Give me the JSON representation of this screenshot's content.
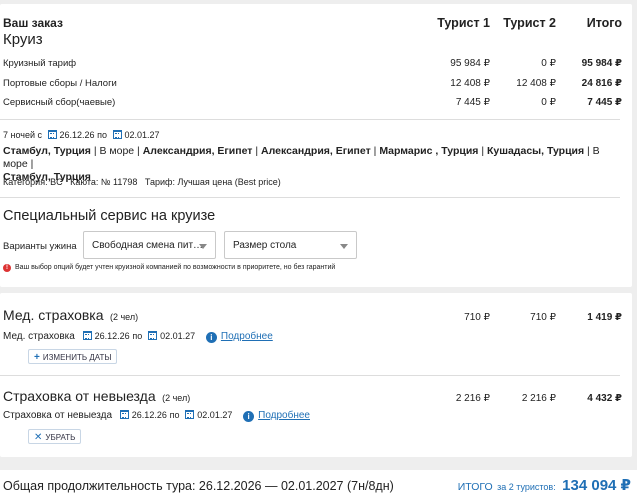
{
  "order": {
    "title": "Ваш заказ",
    "subtitle": "Круиз",
    "columns": [
      "Турист 1",
      "Турист 2",
      "Итого"
    ],
    "rows": [
      {
        "label": "Круизный тариф",
        "t1": "95 984 ₽",
        "t2": "0 ₽",
        "total": "95 984 ₽"
      },
      {
        "label": "Портовые сборы / Налоги",
        "t1": "12 408 ₽",
        "t2": "12 408 ₽",
        "total": "24 816 ₽"
      },
      {
        "label": "Сервисный сбор(чаевые)",
        "t1": "7 445 ₽",
        "t2": "0 ₽",
        "total": "7 445 ₽"
      }
    ]
  },
  "cruise": {
    "nights_prefix": "7 ночей с",
    "date_from": "26.12.26",
    "by": "по",
    "date_to": "02.01.27",
    "route": [
      {
        "text": "Стамбул, Турция",
        "bold": true
      },
      {
        "text": " | В море | ",
        "bold": false
      },
      {
        "text": "Александрия, Египет",
        "bold": true
      },
      {
        "text": " | ",
        "bold": false
      },
      {
        "text": "Александрия, Египет",
        "bold": true
      },
      {
        "text": " | ",
        "bold": false
      },
      {
        "text": "Мармарис , Турция",
        "bold": true
      },
      {
        "text": " | ",
        "bold": false
      },
      {
        "text": "Кушадасы, Турция",
        "bold": true
      },
      {
        "text": " | В море | ",
        "bold": false
      }
    ],
    "route_line2": "Стамбул, Турция",
    "details": "Категория: BC   Каюта: № 11798   Тариф: Лучшая цена (Best price)"
  },
  "service": {
    "title": "Специальный сервис на круизе",
    "dinner_label": "Варианты ужина",
    "dinner_value": "Свободная смена пит…",
    "table_value": "Размер стола",
    "warning": "Ваш выбор опций будет учтен круизной компанией по возможности в приоритете, но без гарантий",
    "warning_icon": "!"
  },
  "med": {
    "title": "Мед. страховка",
    "count": "(2 чел)",
    "t1": "710 ₽",
    "t2": "710 ₽",
    "total": "1 419 ₽",
    "sub_label": "Мед. страховка",
    "date_from": "26.12.26",
    "by": "по",
    "date_to": "02.01.27",
    "more": "Подробнее",
    "button": "ИЗМЕНИТЬ ДАТЫ",
    "button_icon": "+"
  },
  "cancel": {
    "title": "Страховка от невыезда",
    "count": "(2 чел)",
    "t1": "2 216 ₽",
    "t2": "2 216 ₽",
    "total": "4 432 ₽",
    "sub_label": "Страховка от невыезда",
    "date_from": "26.12.26",
    "by": "по",
    "date_to": "02.01.27",
    "more": "Подробнее",
    "button": "УБРАТЬ",
    "button_icon": "✕"
  },
  "footer": {
    "duration": "Общая продолжительность тура: 26.12.2026 — 02.01.2027 (7н/8дн)",
    "total_label": "ИТОГО",
    "total_for": "за 2 туристов:",
    "total_value": "134 094 ₽"
  },
  "info_icon": "i"
}
